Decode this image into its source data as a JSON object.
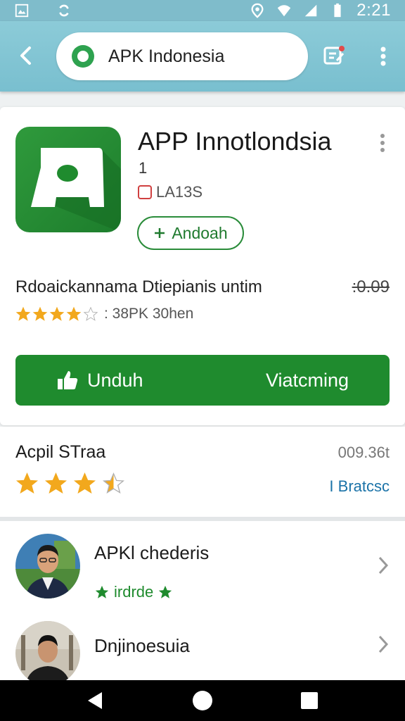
{
  "status_bar": {
    "time": "2:21",
    "icons": [
      "gallery-icon",
      "sync-icon",
      "location-icon",
      "wifi-icon",
      "signal-icon",
      "battery-icon"
    ]
  },
  "app_bar": {
    "search_text": "APK Indonesia",
    "icons": [
      "back-arrow-icon",
      "app-logo-icon",
      "edit-note-icon",
      "more-vert-icon"
    ]
  },
  "app_card": {
    "title": "APP Innotlondsia",
    "cursor": "1",
    "size": "LA13S",
    "install_label": "Andoah",
    "description": "Rdoaickannama Dtiepianis untim",
    "price": ":0.09",
    "rating_text": ": 38PK 30hen",
    "rating_value": 4,
    "download_label": "Unduh",
    "download_right": "Viatcming",
    "accent_color": "#1f8b2e"
  },
  "rating_section": {
    "title": "Acpil STraa",
    "count": "009.36t",
    "rating_value": 3.5,
    "link": "I Bratcsc"
  },
  "list": [
    {
      "title": "APKl chederis",
      "subtitle": "irdrde"
    },
    {
      "title": "Dnjinoesuia",
      "subtitle": ""
    }
  ],
  "nav_bar": {
    "icons": [
      "back-triangle-icon",
      "home-circle-icon",
      "recents-square-icon"
    ]
  }
}
